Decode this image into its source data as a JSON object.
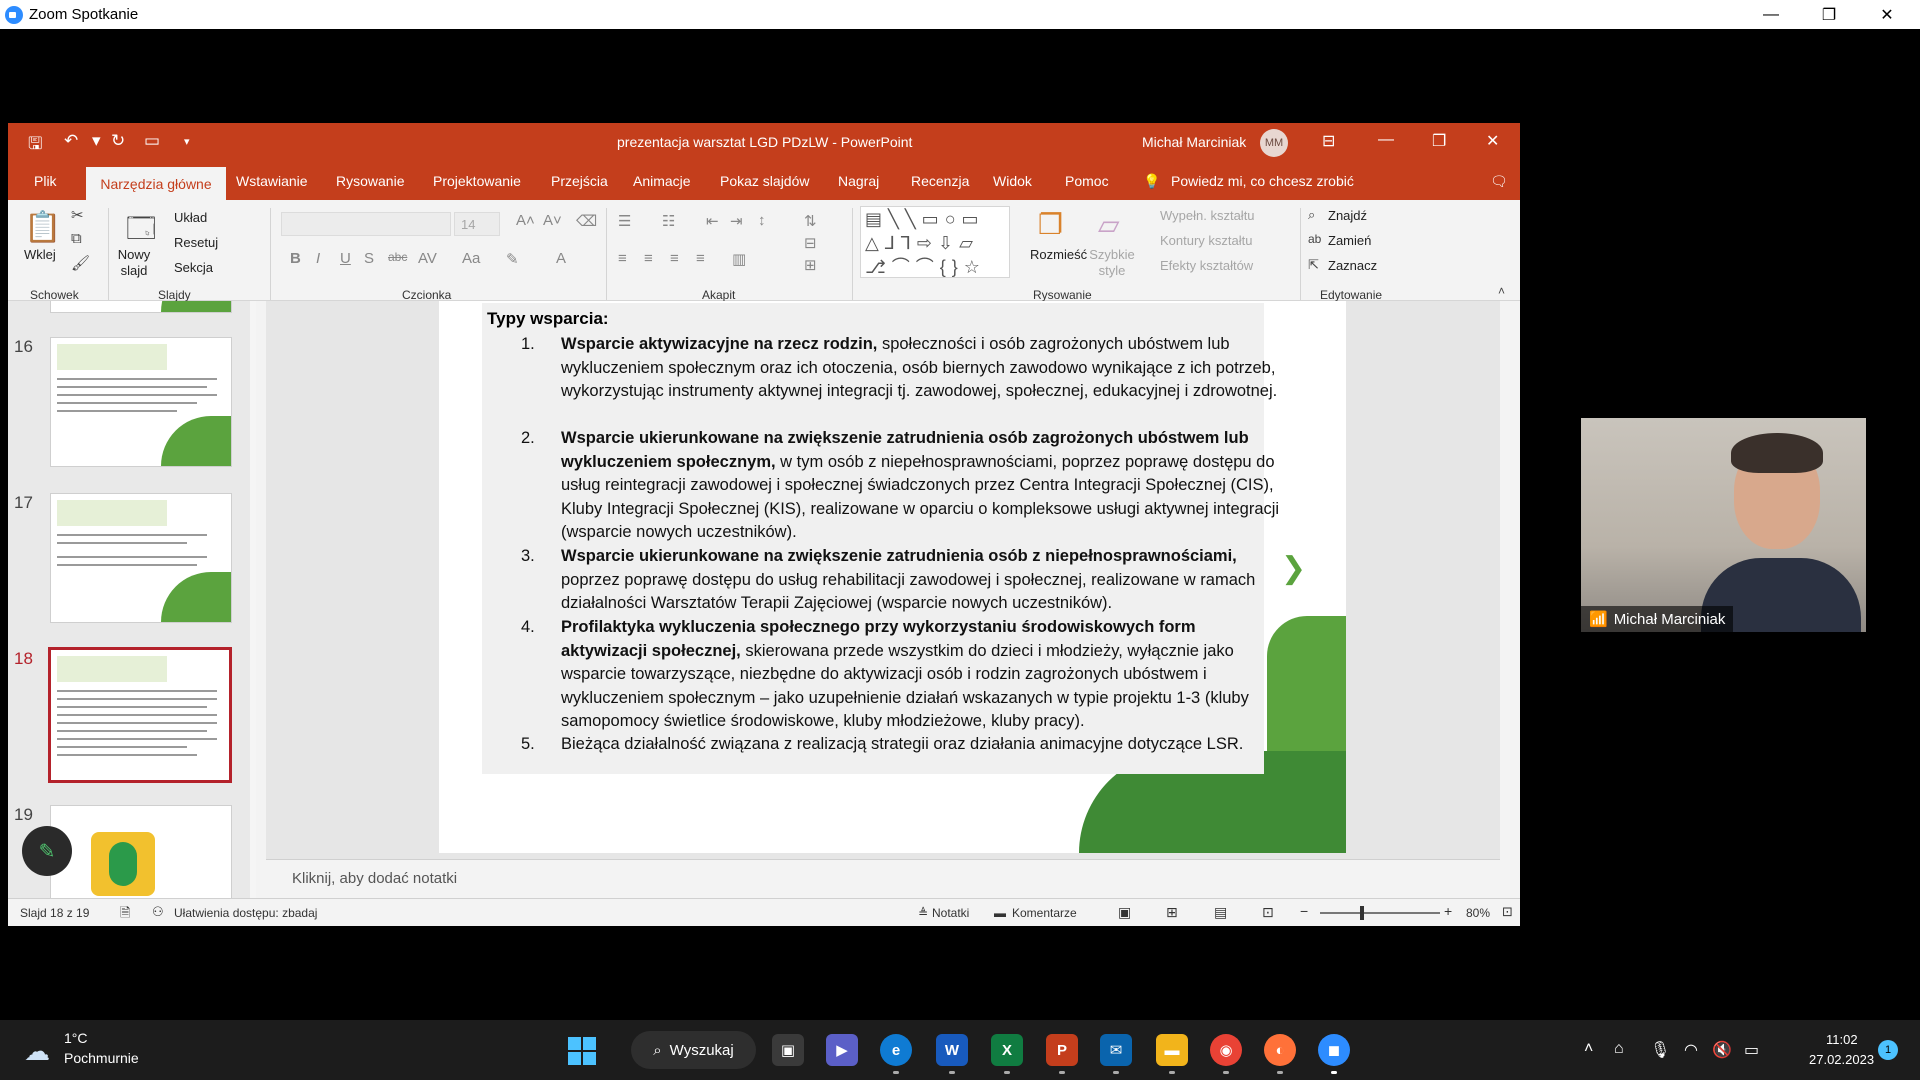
{
  "zoom": {
    "title": "Zoom Spotkanie",
    "participant_name": "Michał Marciniak"
  },
  "ppt": {
    "doc_title": "prezentacja warsztat LGD PDzLW  -  PowerPoint",
    "user_name": "Michał Marciniak",
    "user_initials": "MM",
    "tabs": [
      "Plik",
      "Narzędzia główne",
      "Wstawianie",
      "Rysowanie",
      "Projektowanie",
      "Przejścia",
      "Animacje",
      "Pokaz slajdów",
      "Nagraj",
      "Recenzja",
      "Widok",
      "Pomoc"
    ],
    "tell_me": "Powiedz mi, co chcesz zrobić",
    "ribbon": {
      "paste": "Wklej",
      "new_slide": "Nowy slajd",
      "layout": "Układ",
      "reset": "Resetuj",
      "section": "Sekcja",
      "font_size": "14",
      "arrange": "Rozmieść",
      "quick_styles": "Szybkie style",
      "shape_fill": "Wypełn. kształtu",
      "shape_outline": "Kontury kształtu",
      "shape_effects": "Efekty kształtów",
      "find": "Znajdź",
      "replace": "Zamień",
      "select": "Zaznacz",
      "groups": {
        "clipboard": "Schowek",
        "slides": "Slajdy",
        "font": "Czcionka",
        "paragraph": "Akapit",
        "drawing": "Rysowanie",
        "editing": "Edytowanie"
      }
    },
    "thumbnails": [
      {
        "num": "16"
      },
      {
        "num": "17"
      },
      {
        "num": "18"
      },
      {
        "num": "19"
      }
    ],
    "slide": {
      "heading": "Typy wsparcia:",
      "items": [
        {
          "num": "1.",
          "bold": "Wsparcie aktywizacyjne na rzecz rodzin,",
          "text": " społeczności i osób zagrożonych ubóstwem lub wykluczeniem społecznym oraz ich otoczenia, osób biernych zawodowo wynikające z ich potrzeb, wykorzystując instrumenty aktywnej integracji tj. zawodowej, społecznej, edukacyjnej i zdrowotnej."
        },
        {
          "num": "2.",
          "bold": "Wsparcie ukierunkowane na zwiększenie zatrudnienia osób zagrożonych ubóstwem lub wykluczeniem społecznym,",
          "text": " w tym osób z niepełnosprawnościami, poprzez poprawę dostępu do usług reintegracji zawodowej i społecznej świadczonych przez Centra Integracji Społecznej (CIS), Kluby Integracji Społecznej (KIS), realizowane w oparciu o kompleksowe usługi aktywnej integracji (wsparcie nowych uczestników)."
        },
        {
          "num": "3.",
          "bold": "Wsparcie ukierunkowane na zwiększenie zatrudnienia osób z niepełnosprawnościami,",
          "text": " poprzez poprawę dostępu do usług rehabilitacji zawodowej i społecznej, realizowane w ramach działalności Warsztatów Terapii Zajęciowej (wsparcie nowych uczestników)."
        },
        {
          "num": "4.",
          "bold": "Profilaktyka wykluczenia społecznego przy wykorzystaniu środowiskowych form aktywizacji społecznej,",
          "text": " skierowana przede wszystkim do dzieci i młodzieży, wyłącznie jako wsparcie towarzyszące, niezbędne do aktywizacji osób i rodzin zagrożonych ubóstwem i wykluczeniem społecznym – jako uzupełnienie działań wskazanych w typie projektu  1-3 (kluby samopomocy świetlice środowiskowe, kluby młodzieżowe, kluby pracy)."
        },
        {
          "num": "5.",
          "bold": "",
          "text": "Bieżąca działalność związana z realizacją strategii oraz działania animacyjne dotyczące LSR."
        }
      ]
    },
    "notes_placeholder": "Kliknij, aby dodać notatki",
    "status": {
      "slide_counter": "Slajd 18 z 19",
      "accessibility": "Ułatwienia dostępu: zbadaj",
      "notes": "Notatki",
      "comments": "Komentarze",
      "zoom": "80%"
    }
  },
  "taskbar": {
    "weather_temp": "1°C",
    "weather_desc": "Pochmurnie",
    "search": "Wyszukaj",
    "time": "11:02",
    "date": "27.02.2023",
    "notifications": "1"
  },
  "colors": {
    "ppt_accent": "#c43e1c",
    "zoom_blue": "#2D8CFF",
    "win_accent": "#4cc2ff"
  }
}
